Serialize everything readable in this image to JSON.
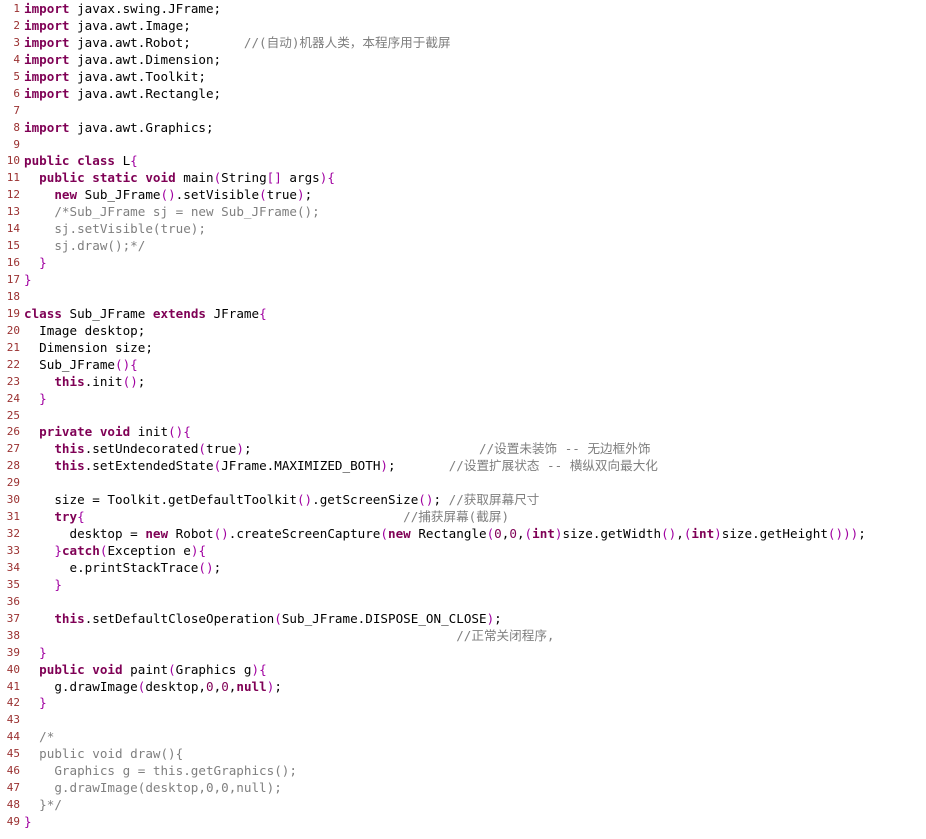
{
  "colors": {
    "keyword": "#7f0055",
    "line_number": "#9a3030",
    "comment": "#7f7f7f",
    "punctuation": "#a000a0",
    "text": "#000000",
    "background": "#ffffff"
  },
  "lines": [
    {
      "n": "1",
      "tokens": [
        {
          "t": "kw",
          "v": "import"
        },
        {
          "t": "tx",
          "v": " javax.swing.JFrame;"
        }
      ]
    },
    {
      "n": "2",
      "tokens": [
        {
          "t": "kw",
          "v": "import"
        },
        {
          "t": "tx",
          "v": " java.awt.Image;"
        }
      ]
    },
    {
      "n": "3",
      "tokens": [
        {
          "t": "kw",
          "v": "import"
        },
        {
          "t": "tx",
          "v": " java.awt.Robot;       "
        },
        {
          "t": "cm",
          "v": "//(自动)机器人类，本程序用于截屏"
        }
      ]
    },
    {
      "n": "4",
      "tokens": [
        {
          "t": "kw",
          "v": "import"
        },
        {
          "t": "tx",
          "v": " java.awt.Dimension;"
        }
      ]
    },
    {
      "n": "5",
      "tokens": [
        {
          "t": "kw",
          "v": "import"
        },
        {
          "t": "tx",
          "v": " java.awt.Toolkit;"
        }
      ]
    },
    {
      "n": "6",
      "tokens": [
        {
          "t": "kw",
          "v": "import"
        },
        {
          "t": "tx",
          "v": " java.awt.Rectangle;"
        }
      ]
    },
    {
      "n": "7",
      "tokens": []
    },
    {
      "n": "8",
      "tokens": [
        {
          "t": "kw",
          "v": "import"
        },
        {
          "t": "tx",
          "v": " java.awt.Graphics;"
        }
      ]
    },
    {
      "n": "9",
      "tokens": []
    },
    {
      "n": "10",
      "tokens": [
        {
          "t": "kw",
          "v": "public class"
        },
        {
          "t": "tx",
          "v": " L"
        },
        {
          "t": "pn",
          "v": "{"
        }
      ]
    },
    {
      "n": "11",
      "tokens": [
        {
          "t": "tx",
          "v": "  "
        },
        {
          "t": "kw",
          "v": "public static void"
        },
        {
          "t": "tx",
          "v": " main"
        },
        {
          "t": "pn",
          "v": "("
        },
        {
          "t": "tx",
          "v": "String"
        },
        {
          "t": "pn",
          "v": "[]"
        },
        {
          "t": "tx",
          "v": " args"
        },
        {
          "t": "pn",
          "v": "){"
        }
      ]
    },
    {
      "n": "12",
      "tokens": [
        {
          "t": "tx",
          "v": "    "
        },
        {
          "t": "kw",
          "v": "new"
        },
        {
          "t": "tx",
          "v": " Sub_JFrame"
        },
        {
          "t": "pn",
          "v": "()"
        },
        {
          "t": "tx",
          "v": ".setVisible"
        },
        {
          "t": "pn",
          "v": "("
        },
        {
          "t": "tx",
          "v": "true"
        },
        {
          "t": "pn",
          "v": ")"
        },
        {
          "t": "tx",
          "v": ";"
        }
      ]
    },
    {
      "n": "13",
      "tokens": [
        {
          "t": "tx",
          "v": "    "
        },
        {
          "t": "cm",
          "v": "/*Sub_JFrame sj = new Sub_JFrame();"
        }
      ]
    },
    {
      "n": "14",
      "tokens": [
        {
          "t": "cm",
          "v": "    sj.setVisible(true);"
        }
      ]
    },
    {
      "n": "15",
      "tokens": [
        {
          "t": "cm",
          "v": "    sj.draw();*/"
        }
      ]
    },
    {
      "n": "16",
      "tokens": [
        {
          "t": "tx",
          "v": "  "
        },
        {
          "t": "pn",
          "v": "}"
        }
      ]
    },
    {
      "n": "17",
      "tokens": [
        {
          "t": "pn",
          "v": "}"
        }
      ]
    },
    {
      "n": "18",
      "tokens": []
    },
    {
      "n": "19",
      "tokens": [
        {
          "t": "kw",
          "v": "class"
        },
        {
          "t": "tx",
          "v": " Sub_JFrame "
        },
        {
          "t": "kw",
          "v": "extends"
        },
        {
          "t": "tx",
          "v": " JFrame"
        },
        {
          "t": "pn",
          "v": "{"
        }
      ]
    },
    {
      "n": "20",
      "tokens": [
        {
          "t": "tx",
          "v": "  Image desktop;"
        }
      ]
    },
    {
      "n": "21",
      "tokens": [
        {
          "t": "tx",
          "v": "  Dimension size;"
        }
      ]
    },
    {
      "n": "22",
      "tokens": [
        {
          "t": "tx",
          "v": "  Sub_JFrame"
        },
        {
          "t": "pn",
          "v": "(){"
        }
      ]
    },
    {
      "n": "23",
      "tokens": [
        {
          "t": "tx",
          "v": "    "
        },
        {
          "t": "kw",
          "v": "this"
        },
        {
          "t": "tx",
          "v": ".init"
        },
        {
          "t": "pn",
          "v": "()"
        },
        {
          "t": "tx",
          "v": ";"
        }
      ]
    },
    {
      "n": "24",
      "tokens": [
        {
          "t": "tx",
          "v": "  "
        },
        {
          "t": "pn",
          "v": "}"
        }
      ]
    },
    {
      "n": "25",
      "tokens": []
    },
    {
      "n": "26",
      "tokens": [
        {
          "t": "tx",
          "v": "  "
        },
        {
          "t": "kw",
          "v": "private void"
        },
        {
          "t": "tx",
          "v": " init"
        },
        {
          "t": "pn",
          "v": "(){"
        }
      ]
    },
    {
      "n": "27",
      "tokens": [
        {
          "t": "tx",
          "v": "    "
        },
        {
          "t": "kw",
          "v": "this"
        },
        {
          "t": "tx",
          "v": ".setUndecorated"
        },
        {
          "t": "pn",
          "v": "("
        },
        {
          "t": "tx",
          "v": "true"
        },
        {
          "t": "pn",
          "v": ")"
        },
        {
          "t": "tx",
          "v": ";                              "
        },
        {
          "t": "cm",
          "v": "//设置未装饰 -- 无边框外饰"
        }
      ]
    },
    {
      "n": "28",
      "tokens": [
        {
          "t": "tx",
          "v": "    "
        },
        {
          "t": "kw",
          "v": "this"
        },
        {
          "t": "tx",
          "v": ".setExtendedState"
        },
        {
          "t": "pn",
          "v": "("
        },
        {
          "t": "tx",
          "v": "JFrame.MAXIMIZED_BOTH"
        },
        {
          "t": "pn",
          "v": ")"
        },
        {
          "t": "tx",
          "v": ";       "
        },
        {
          "t": "cm",
          "v": "//设置扩展状态 -- 横纵双向最大化"
        }
      ]
    },
    {
      "n": "29",
      "tokens": []
    },
    {
      "n": "30",
      "tokens": [
        {
          "t": "tx",
          "v": "    size = Toolkit.getDefaultToolkit"
        },
        {
          "t": "pn",
          "v": "()"
        },
        {
          "t": "tx",
          "v": ".getScreenSize"
        },
        {
          "t": "pn",
          "v": "()"
        },
        {
          "t": "tx",
          "v": "; "
        },
        {
          "t": "cm",
          "v": "//获取屏幕尺寸"
        }
      ]
    },
    {
      "n": "31",
      "tokens": [
        {
          "t": "tx",
          "v": "    "
        },
        {
          "t": "kw",
          "v": "try"
        },
        {
          "t": "pn",
          "v": "{"
        },
        {
          "t": "tx",
          "v": "                                          "
        },
        {
          "t": "cm",
          "v": "//捕获屏幕(截屏)"
        }
      ]
    },
    {
      "n": "32",
      "tokens": [
        {
          "t": "tx",
          "v": "      desktop = "
        },
        {
          "t": "kw",
          "v": "new"
        },
        {
          "t": "tx",
          "v": " Robot"
        },
        {
          "t": "pn",
          "v": "()"
        },
        {
          "t": "tx",
          "v": ".createScreenCapture"
        },
        {
          "t": "pn",
          "v": "("
        },
        {
          "t": "kw",
          "v": "new"
        },
        {
          "t": "tx",
          "v": " Rectangle"
        },
        {
          "t": "pn",
          "v": "("
        },
        {
          "t": "num",
          "v": "0"
        },
        {
          "t": "tx",
          "v": ","
        },
        {
          "t": "num",
          "v": "0"
        },
        {
          "t": "tx",
          "v": ","
        },
        {
          "t": "pn",
          "v": "("
        },
        {
          "t": "kw",
          "v": "int"
        },
        {
          "t": "pn",
          "v": ")"
        },
        {
          "t": "tx",
          "v": "size.getWidth"
        },
        {
          "t": "pn",
          "v": "()"
        },
        {
          "t": "tx",
          "v": ","
        },
        {
          "t": "pn",
          "v": "("
        },
        {
          "t": "kw",
          "v": "int"
        },
        {
          "t": "pn",
          "v": ")"
        },
        {
          "t": "tx",
          "v": "size.getHeight"
        },
        {
          "t": "pn",
          "v": "()))"
        },
        {
          "t": "tx",
          "v": ";"
        }
      ]
    },
    {
      "n": "33",
      "tokens": [
        {
          "t": "tx",
          "v": "    "
        },
        {
          "t": "pn",
          "v": "}"
        },
        {
          "t": "kw",
          "v": "catch"
        },
        {
          "t": "pn",
          "v": "("
        },
        {
          "t": "tx",
          "v": "Exception e"
        },
        {
          "t": "pn",
          "v": "){"
        }
      ]
    },
    {
      "n": "34",
      "tokens": [
        {
          "t": "tx",
          "v": "      e.printStackTrace"
        },
        {
          "t": "pn",
          "v": "()"
        },
        {
          "t": "tx",
          "v": ";"
        }
      ]
    },
    {
      "n": "35",
      "tokens": [
        {
          "t": "tx",
          "v": "    "
        },
        {
          "t": "pn",
          "v": "}"
        }
      ]
    },
    {
      "n": "36",
      "tokens": []
    },
    {
      "n": "37",
      "tokens": [
        {
          "t": "tx",
          "v": "    "
        },
        {
          "t": "kw",
          "v": "this"
        },
        {
          "t": "tx",
          "v": ".setDefaultCloseOperation"
        },
        {
          "t": "pn",
          "v": "("
        },
        {
          "t": "tx",
          "v": "Sub_JFrame.DISPOSE_ON_CLOSE"
        },
        {
          "t": "pn",
          "v": ")"
        },
        {
          "t": "tx",
          "v": ";"
        }
      ]
    },
    {
      "n": "38",
      "tokens": [
        {
          "t": "tx",
          "v": "                                                         "
        },
        {
          "t": "cm",
          "v": "//正常关闭程序,"
        }
      ]
    },
    {
      "n": "39",
      "tokens": [
        {
          "t": "tx",
          "v": "  "
        },
        {
          "t": "pn",
          "v": "}"
        }
      ]
    },
    {
      "n": "40",
      "tokens": [
        {
          "t": "tx",
          "v": "  "
        },
        {
          "t": "kw",
          "v": "public void"
        },
        {
          "t": "tx",
          "v": " paint"
        },
        {
          "t": "pn",
          "v": "("
        },
        {
          "t": "tx",
          "v": "Graphics g"
        },
        {
          "t": "pn",
          "v": "){"
        }
      ]
    },
    {
      "n": "41",
      "tokens": [
        {
          "t": "tx",
          "v": "    g.drawImage"
        },
        {
          "t": "pn",
          "v": "("
        },
        {
          "t": "tx",
          "v": "desktop,"
        },
        {
          "t": "num",
          "v": "0"
        },
        {
          "t": "tx",
          "v": ","
        },
        {
          "t": "num",
          "v": "0"
        },
        {
          "t": "tx",
          "v": ","
        },
        {
          "t": "kw",
          "v": "null"
        },
        {
          "t": "pn",
          "v": ")"
        },
        {
          "t": "tx",
          "v": ";"
        }
      ]
    },
    {
      "n": "42",
      "tokens": [
        {
          "t": "tx",
          "v": "  "
        },
        {
          "t": "pn",
          "v": "}"
        }
      ]
    },
    {
      "n": "43",
      "tokens": []
    },
    {
      "n": "44",
      "tokens": [
        {
          "t": "cm",
          "v": "  /*"
        }
      ]
    },
    {
      "n": "45",
      "tokens": [
        {
          "t": "cm",
          "v": "  public void draw(){"
        }
      ]
    },
    {
      "n": "46",
      "tokens": [
        {
          "t": "cm",
          "v": "    Graphics g = this.getGraphics();"
        }
      ]
    },
    {
      "n": "47",
      "tokens": [
        {
          "t": "cm",
          "v": "    g.drawImage(desktop,0,0,null);"
        }
      ]
    },
    {
      "n": "48",
      "tokens": [
        {
          "t": "cm",
          "v": "  }*/"
        }
      ]
    },
    {
      "n": "49",
      "tokens": [
        {
          "t": "pn",
          "v": "}"
        }
      ]
    }
  ]
}
